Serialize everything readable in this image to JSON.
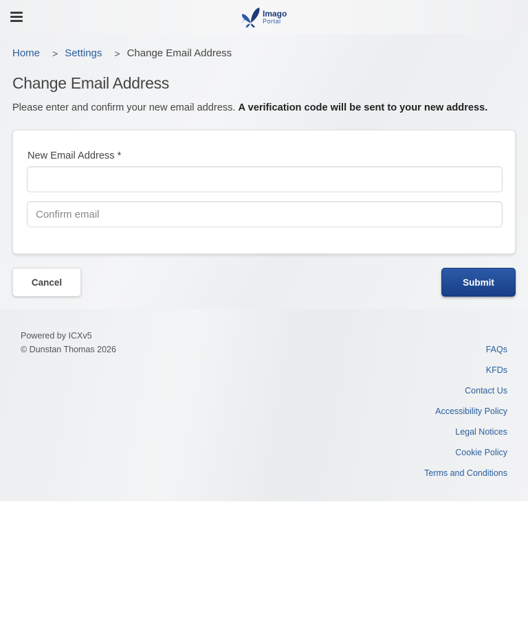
{
  "header": {
    "menu_icon": "hamburger-menu-icon",
    "logo": {
      "brand": "Imago",
      "sub": "Portal",
      "icon": "butterfly-logo-icon",
      "color": "#1e3a78"
    }
  },
  "breadcrumb": {
    "home": "Home",
    "separator": ">",
    "settings": "Settings",
    "current": "Change Email Address"
  },
  "page": {
    "title": "Change Email Address",
    "intro_text": "Please enter and confirm your new email address.",
    "intro_bold": "A verification code will be sent to your new address."
  },
  "form": {
    "email_label": "New Email Address *",
    "email_value": "",
    "confirm_placeholder": "Confirm email",
    "confirm_value": ""
  },
  "actions": {
    "cancel_label": "Cancel",
    "submit_label": "Submit",
    "submit_color": "#1f4a94"
  },
  "footer": {
    "powered_by": "Powered by ICXv5",
    "copyright": "© Dunstan Thomas 2026",
    "links": [
      "FAQs",
      "KFDs",
      "Contact Us",
      "Accessibility Policy",
      "Legal Notices",
      "Cookie Policy",
      "Terms and Conditions"
    ]
  }
}
